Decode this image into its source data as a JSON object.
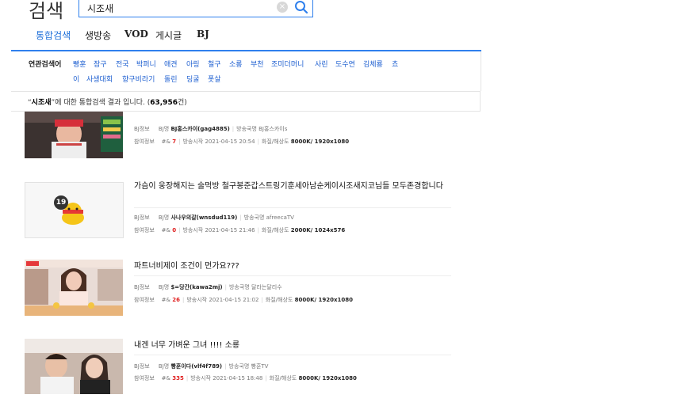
{
  "header": {
    "title": "검색",
    "search_value": "시조새",
    "clear_symbol": "×"
  },
  "tabs": [
    {
      "label": "통합검색"
    },
    {
      "label": "생방송"
    },
    {
      "label": "VOD"
    },
    {
      "label": "게시글"
    },
    {
      "label": "BJ"
    }
  ],
  "related": {
    "label": "연관검색어",
    "row1": [
      "빵훈",
      "잠구",
      "전국",
      "박퍼니",
      "애견",
      "아링",
      "철구",
      "소룡",
      "부천",
      "조미더머니",
      "사린",
      "도수연",
      "김체룡",
      "쵸"
    ],
    "row2": [
      "이",
      "사생대회",
      "향구비라기",
      "돌린",
      "딩굴",
      "폿살"
    ]
  },
  "result_count": {
    "open_quote": "“",
    "keyword": "시조새",
    "close_quote": "”",
    "text": "에 대한 통합검색 결과 입니다. (",
    "count": "63,956",
    "unit": "건)"
  },
  "labels": {
    "bj_info": "BJ정보",
    "bj_name": "BJ명",
    "broadcast_name": "방송국명",
    "viewer_info": "참여정보",
    "viewer_prefix": "#&",
    "start": "방송시작",
    "quality": "화질/해상도"
  },
  "results": [
    {
      "title": "",
      "bj": "BJ홍스카이(gag4885)",
      "station": "BJ홍스카이s",
      "viewers": "7",
      "start": "2021-04-15 20:54",
      "quality": "8000K/ 1920x1080"
    },
    {
      "title": "가슴이 웅장해지는 술먹방 철구봉준갑스트링기훈세아남순케이시조새지코님들 모두존경합니다",
      "bj": "사나우의갈(wnsdud119)",
      "station": "afreecaTV",
      "viewers": "0",
      "start": "2021-04-15 21:46",
      "quality": "2000K/ 1024x576"
    },
    {
      "title": "파트너비제이 조건이 먼가요???",
      "bj": "$=당간(kawa2mj)",
      "station": "달라는달리수",
      "viewers": "26",
      "start": "2021-04-15 21:02",
      "quality": "8000K/ 1920x1080"
    },
    {
      "title": "내겐 너무 가벼운 그녀 !!!! 소룡",
      "bj": "빵훈이다(vlf4f789)",
      "station": "빵훈TV",
      "viewers": "335",
      "start": "2021-04-15 18:48",
      "quality": "8000K/ 1920x1080"
    }
  ],
  "age_badge": "19",
  "colors": {
    "accent": "#2f80ed",
    "link": "#1e5fd0",
    "viewer_count": "#e02020"
  }
}
